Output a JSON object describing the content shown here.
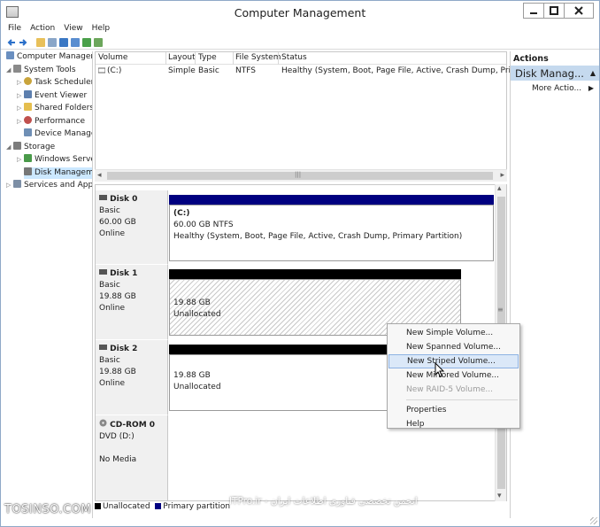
{
  "window": {
    "title": "Computer Management"
  },
  "menu": [
    "File",
    "Action",
    "View",
    "Help"
  ],
  "tree": [
    {
      "label": "Computer Managem",
      "expander": "",
      "icon": "computer-icon"
    },
    {
      "label": "System Tools",
      "expander": "◢",
      "icon": "tools-icon"
    },
    {
      "label": "Task Scheduler",
      "expander": "▷",
      "icon": "clock-icon"
    },
    {
      "label": "Event Viewer",
      "expander": "▷",
      "icon": "event-viewer-icon"
    },
    {
      "label": "Shared Folders",
      "expander": "▷",
      "icon": "shared-folder-icon"
    },
    {
      "label": "Performance",
      "expander": "▷",
      "icon": "performance-icon"
    },
    {
      "label": "Device Manager",
      "expander": "",
      "icon": "device-manager-icon"
    },
    {
      "label": "Storage",
      "expander": "◢",
      "icon": "storage-icon"
    },
    {
      "label": "Windows Server",
      "expander": "▷",
      "icon": "backup-icon"
    },
    {
      "label": "Disk Manageme",
      "expander": "",
      "icon": "disk-management-icon"
    },
    {
      "label": "Services and Appli",
      "expander": "▷",
      "icon": "services-icon"
    }
  ],
  "volumes": {
    "headers": [
      "Volume",
      "Layout",
      "Type",
      "File System",
      "Status"
    ],
    "rows": [
      {
        "volume": "(C:)",
        "layout": "Simple",
        "type": "Basic",
        "fs": "NTFS",
        "status": "Healthy (System, Boot, Page File, Active, Crash Dump, Primary"
      }
    ]
  },
  "disks": [
    {
      "name": "Disk 0",
      "type": "Basic",
      "size": "60.00 GB",
      "state": "Online",
      "partition": {
        "label": "(C:)",
        "size": "60.00 GB NTFS",
        "status": "Healthy (System, Boot, Page File, Active, Crash Dump, Primary Partition)"
      }
    },
    {
      "name": "Disk 1",
      "type": "Basic",
      "size": "19.88 GB",
      "state": "Online",
      "partition": {
        "size": "19.88 GB",
        "status": "Unallocated"
      }
    },
    {
      "name": "Disk 2",
      "type": "Basic",
      "size": "19.88 GB",
      "state": "Online",
      "partition": {
        "size": "19.88 GB",
        "status": "Unallocated"
      }
    },
    {
      "name": "CD-ROM 0",
      "type": "DVD (D:)",
      "size": "",
      "state": "No Media"
    }
  ],
  "legend": {
    "unallocated": "Unallocated",
    "primary": "Primary partition"
  },
  "actions": {
    "header": "Actions",
    "selected": "Disk Manag...",
    "more": "More Actio..."
  },
  "context_menu": {
    "items": [
      {
        "label": "New Simple Volume...",
        "enabled": true
      },
      {
        "label": "New Spanned Volume...",
        "enabled": true
      },
      {
        "label": "New Striped Volume...",
        "enabled": true,
        "highlighted": true
      },
      {
        "label": "New Mirrored Volume...",
        "enabled": true
      },
      {
        "label": "New RAID-5 Volume...",
        "enabled": false
      }
    ],
    "items2": [
      {
        "label": "Properties",
        "enabled": true
      },
      {
        "label": "Help",
        "enabled": true
      }
    ]
  },
  "watermarks": {
    "left": "TOSINSO.COM",
    "center": "انجمن تخصصی فناوری اطلاعات ایران - ITPro.ir"
  },
  "colors": {
    "primary_partition": "#000080",
    "unallocated": "#000000",
    "selection": "#cce8ff",
    "accent": "#c5d9ee"
  }
}
